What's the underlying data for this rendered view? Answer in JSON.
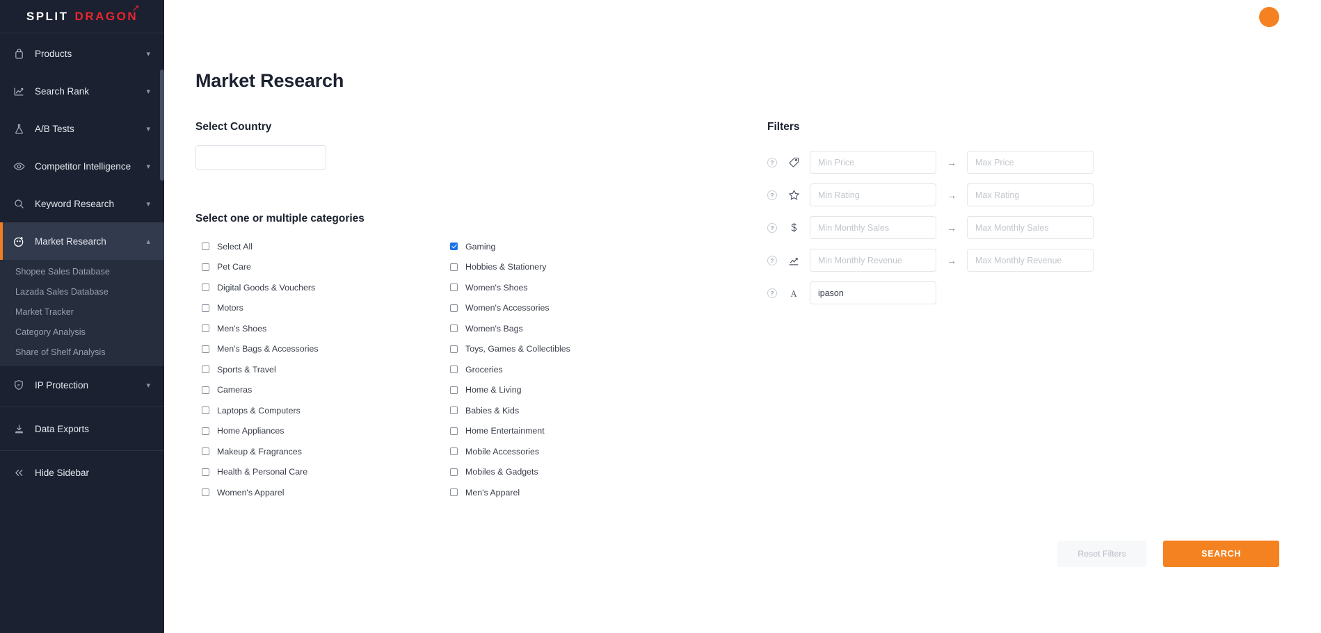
{
  "brand": {
    "name_primary": "SPLIT",
    "name_secondary": "DRAGON",
    "color_primary": "#ffffff",
    "color_secondary": "#e8262d"
  },
  "colors": {
    "sidebar_bg": "#1b2130",
    "sidebar_active_bg": "#323a4d",
    "submenu_bg": "#262d3d",
    "accent_orange": "#f58220",
    "checkbox_checked": "#1a73e8",
    "avatar": "#f58220"
  },
  "sidebar": {
    "items": [
      {
        "label": "Products",
        "icon": "bag-icon",
        "expandable": true,
        "expanded": false
      },
      {
        "label": "Search Rank",
        "icon": "line-chart-icon",
        "expandable": true,
        "expanded": false
      },
      {
        "label": "A/B Tests",
        "icon": "flask-icon",
        "expandable": true,
        "expanded": false
      },
      {
        "label": "Competitor Intelligence",
        "icon": "eye-icon",
        "expandable": true,
        "expanded": false
      },
      {
        "label": "Keyword Research",
        "icon": "search-icon",
        "expandable": true,
        "expanded": false
      },
      {
        "label": "Market Research",
        "icon": "target-icon",
        "expandable": true,
        "expanded": true,
        "active": true
      },
      {
        "label": "IP Protection",
        "icon": "shield-ip-icon",
        "expandable": true,
        "expanded": false
      },
      {
        "label": "Data Exports",
        "icon": "download-icon",
        "expandable": false,
        "expanded": false
      },
      {
        "label": "Hide Sidebar",
        "icon": "double-chevron-left-icon",
        "expandable": false,
        "expanded": false
      }
    ],
    "market_research_submenu": [
      "Shopee Sales Database",
      "Lazada Sales Database",
      "Market Tracker",
      "Category Analysis",
      "Share of Shelf Analysis"
    ]
  },
  "header": {
    "page_title": "Market Research"
  },
  "country": {
    "label": "Select Country",
    "value": "",
    "placeholder": ""
  },
  "categories": {
    "title": "Select one or multiple categories",
    "left": [
      {
        "label": "Select All",
        "checked": false
      },
      {
        "label": "Pet Care",
        "checked": false
      },
      {
        "label": "Digital Goods & Vouchers",
        "checked": false
      },
      {
        "label": "Motors",
        "checked": false
      },
      {
        "label": "Men's Shoes",
        "checked": false
      },
      {
        "label": "Men's Bags & Accessories",
        "checked": false
      },
      {
        "label": "Sports & Travel",
        "checked": false
      },
      {
        "label": "Cameras",
        "checked": false
      },
      {
        "label": "Laptops & Computers",
        "checked": false
      },
      {
        "label": "Home Appliances",
        "checked": false
      },
      {
        "label": "Makeup & Fragrances",
        "checked": false
      },
      {
        "label": "Health & Personal Care",
        "checked": false
      },
      {
        "label": "Women's Apparel",
        "checked": false
      }
    ],
    "right": [
      {
        "label": "Gaming",
        "checked": true
      },
      {
        "label": "Hobbies & Stationery",
        "checked": false
      },
      {
        "label": "Women's Shoes",
        "checked": false
      },
      {
        "label": "Women's Accessories",
        "checked": false
      },
      {
        "label": "Women's Bags",
        "checked": false
      },
      {
        "label": "Toys, Games & Collectibles",
        "checked": false
      },
      {
        "label": "Groceries",
        "checked": false
      },
      {
        "label": "Home & Living",
        "checked": false
      },
      {
        "label": "Babies & Kids",
        "checked": false
      },
      {
        "label": "Home Entertainment",
        "checked": false
      },
      {
        "label": "Mobile Accessories",
        "checked": false
      },
      {
        "label": "Mobiles & Gadgets",
        "checked": false
      },
      {
        "label": "Men's Apparel",
        "checked": false
      }
    ]
  },
  "filters": {
    "title": "Filters",
    "help_glyph": "?",
    "arrow_glyph": "→",
    "rows": [
      {
        "icon": "price-tag-icon",
        "min_placeholder": "Min Price",
        "min_value": "",
        "max_placeholder": "Max Price",
        "max_value": "",
        "has_max": true
      },
      {
        "icon": "star-icon",
        "min_placeholder": "Min Rating",
        "min_value": "",
        "max_placeholder": "Max Rating",
        "max_value": "",
        "has_max": true
      },
      {
        "icon": "dollar-icon",
        "min_placeholder": "Min Monthly Sales",
        "min_value": "",
        "max_placeholder": "Max Monthly Sales",
        "max_value": "",
        "has_max": true
      },
      {
        "icon": "revenue-chart-icon",
        "min_placeholder": "Min Monthly Revenue",
        "min_value": "",
        "max_placeholder": "Max Monthly Revenue",
        "max_value": "",
        "has_max": true
      },
      {
        "icon": "text-a-icon",
        "min_placeholder": "",
        "min_value": "ipason",
        "max_placeholder": "",
        "max_value": "",
        "has_max": false
      }
    ]
  },
  "actions": {
    "reset_label": "Reset Filters",
    "search_label": "SEARCH"
  }
}
